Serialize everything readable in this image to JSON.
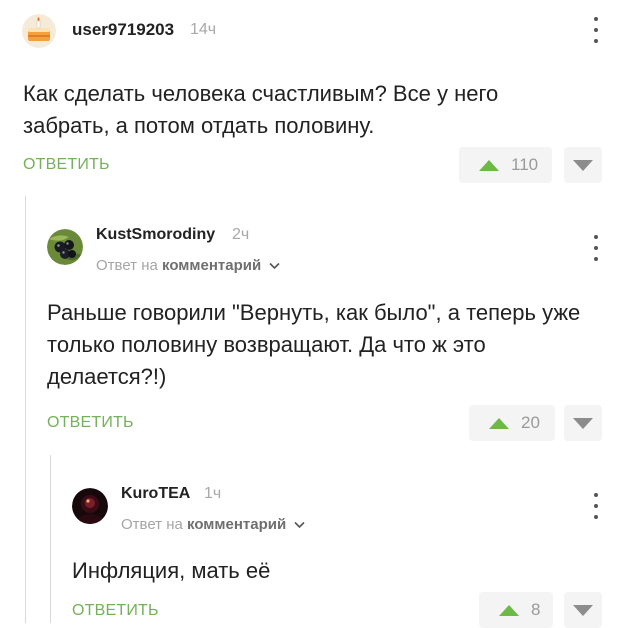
{
  "comments": [
    {
      "username": "user9719203",
      "time": "14ч",
      "text": "Как сделать человека счастливым? Все у него забрать, а потом отдать половину.",
      "reply_label": "ОТВЕТИТЬ",
      "votes": "110",
      "avatar_icon": "cake-icon"
    },
    {
      "username": "KustSmorodiny",
      "time": "2ч",
      "reply_to_prefix": "Ответ на",
      "reply_to_target": "комментарий",
      "text": "Раньше говорили \"Вернуть, как было\", а теперь уже только половину возвращают. Да что ж это делается?!)",
      "reply_label": "ОТВЕТИТЬ",
      "votes": "20",
      "avatar_icon": "currant-berries-icon"
    },
    {
      "username": "KuroTEA",
      "time": "1ч",
      "reply_to_prefix": "Ответ на",
      "reply_to_target": "комментарий",
      "text": "Инфляция, мать её",
      "reply_label": "ОТВЕТИТЬ",
      "votes": "8",
      "avatar_icon": "dark-photo-avatar"
    }
  ],
  "colors": {
    "accent_green": "#74b15a",
    "upvote_arrow": "#6cba45",
    "downvote_arrow": "#8c8c8c",
    "vote_bg": "#f4f4f4",
    "thread_line": "#d8d8d8"
  }
}
